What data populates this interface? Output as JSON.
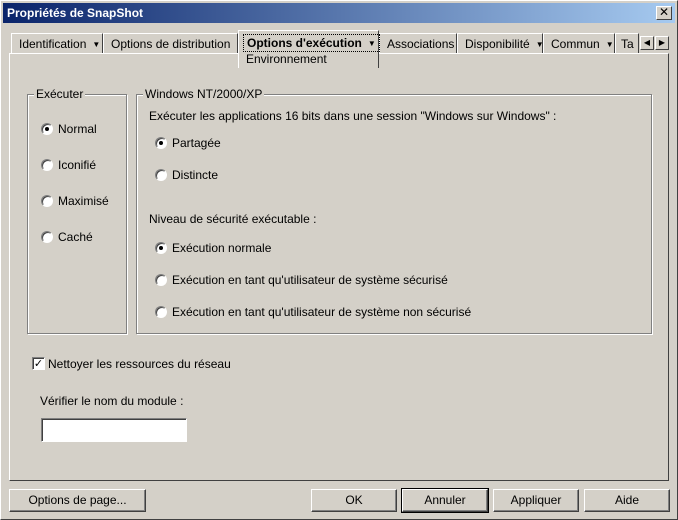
{
  "window": {
    "title": "Propriétés de SnapShot",
    "close_glyph": "✕"
  },
  "tabs": [
    {
      "label": "Identification",
      "has_menu": true
    },
    {
      "label": "Options de distribution",
      "has_menu": true
    },
    {
      "label": "Options d'exécution",
      "has_menu": true,
      "active": true,
      "sub_label": "Environnement"
    },
    {
      "label": "Associations",
      "has_menu": false
    },
    {
      "label": "Disponibilité",
      "has_menu": true
    },
    {
      "label": "Commun",
      "has_menu": true
    },
    {
      "label": "Ta",
      "has_menu": false
    }
  ],
  "tab_arrow_glyph": "▼",
  "tab_scroll": {
    "left_glyph": "◀",
    "right_glyph": "▶"
  },
  "executer": {
    "legend": "Exécuter",
    "options": [
      {
        "label": "Normal",
        "checked": true
      },
      {
        "label": "Iconifié",
        "checked": false
      },
      {
        "label": "Maximisé",
        "checked": false
      },
      {
        "label": "Caché",
        "checked": false
      }
    ]
  },
  "windows_nt": {
    "legend": "Windows NT/2000/XP",
    "session_label": "Exécuter les applications 16 bits dans une session \"Windows sur Windows\" :",
    "session_options": [
      {
        "label": "Partagée",
        "checked": true
      },
      {
        "label": "Distincte",
        "checked": false
      }
    ],
    "security_label": "Niveau de sécurité exécutable :",
    "security_options": [
      {
        "label": "Exécution normale",
        "checked": true
      },
      {
        "label": "Exécution en tant qu'utilisateur de système sécurisé",
        "checked": false
      },
      {
        "label": "Exécution en tant qu'utilisateur de système non sécurisé",
        "checked": false
      }
    ]
  },
  "cleanup": {
    "label": "Nettoyer les ressources du réseau",
    "checked": true,
    "check_glyph": "✓"
  },
  "module": {
    "label": "Vérifier le nom du module :",
    "value": ""
  },
  "buttons": {
    "page_options": "Options de page...",
    "ok": "OK",
    "cancel": "Annuler",
    "apply": "Appliquer",
    "help": "Aide"
  }
}
